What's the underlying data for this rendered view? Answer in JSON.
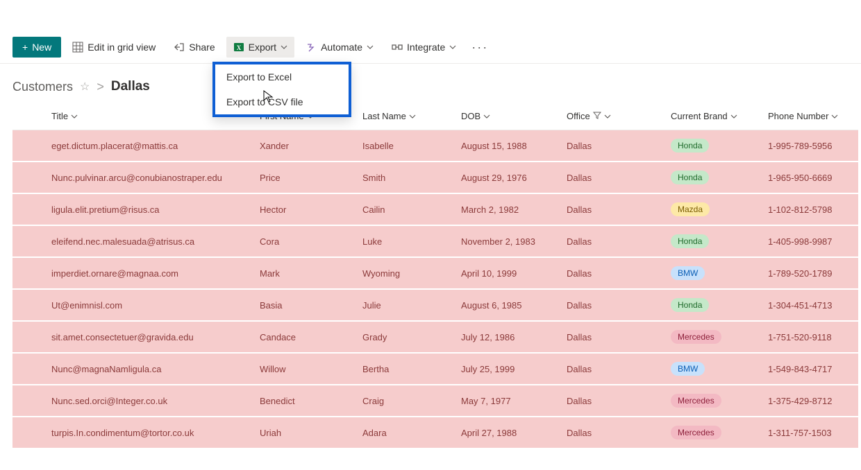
{
  "toolbar": {
    "new_label": "New",
    "edit_label": "Edit in grid view",
    "share_label": "Share",
    "export_label": "Export",
    "automate_label": "Automate",
    "integrate_label": "Integrate"
  },
  "export_menu": {
    "excel": "Export to Excel",
    "csv": "Export to CSV file"
  },
  "breadcrumb": {
    "root": "Customers",
    "current": "Dallas"
  },
  "columns": {
    "title": "Title",
    "first_name": "First Name",
    "last_name": "Last Name",
    "dob": "DOB",
    "office": "Office",
    "brand": "Current Brand",
    "phone": "Phone Number"
  },
  "rows": [
    {
      "title": "eget.dictum.placerat@mattis.ca",
      "first": "Xander",
      "last": "Isabelle",
      "dob": "August 15, 1988",
      "office": "Dallas",
      "brand": "Honda",
      "brand_class": "honda",
      "phone": "1-995-789-5956"
    },
    {
      "title": "Nunc.pulvinar.arcu@conubianostraper.edu",
      "first": "Price",
      "last": "Smith",
      "dob": "August 29, 1976",
      "office": "Dallas",
      "brand": "Honda",
      "brand_class": "honda",
      "phone": "1-965-950-6669"
    },
    {
      "title": "ligula.elit.pretium@risus.ca",
      "first": "Hector",
      "last": "Cailin",
      "dob": "March 2, 1982",
      "office": "Dallas",
      "brand": "Mazda",
      "brand_class": "mazda",
      "phone": "1-102-812-5798"
    },
    {
      "title": "eleifend.nec.malesuada@atrisus.ca",
      "first": "Cora",
      "last": "Luke",
      "dob": "November 2, 1983",
      "office": "Dallas",
      "brand": "Honda",
      "brand_class": "honda",
      "phone": "1-405-998-9987"
    },
    {
      "title": "imperdiet.ornare@magnaa.com",
      "first": "Mark",
      "last": "Wyoming",
      "dob": "April 10, 1999",
      "office": "Dallas",
      "brand": "BMW",
      "brand_class": "bmw",
      "phone": "1-789-520-1789"
    },
    {
      "title": "Ut@enimnisl.com",
      "first": "Basia",
      "last": "Julie",
      "dob": "August 6, 1985",
      "office": "Dallas",
      "brand": "Honda",
      "brand_class": "honda",
      "phone": "1-304-451-4713"
    },
    {
      "title": "sit.amet.consectetuer@gravida.edu",
      "first": "Candace",
      "last": "Grady",
      "dob": "July 12, 1986",
      "office": "Dallas",
      "brand": "Mercedes",
      "brand_class": "mercedes",
      "phone": "1-751-520-9118"
    },
    {
      "title": "Nunc@magnaNamligula.ca",
      "first": "Willow",
      "last": "Bertha",
      "dob": "July 25, 1999",
      "office": "Dallas",
      "brand": "BMW",
      "brand_class": "bmw",
      "phone": "1-549-843-4717"
    },
    {
      "title": "Nunc.sed.orci@Integer.co.uk",
      "first": "Benedict",
      "last": "Craig",
      "dob": "May 7, 1977",
      "office": "Dallas",
      "brand": "Mercedes",
      "brand_class": "mercedes",
      "phone": "1-375-429-8712"
    },
    {
      "title": "turpis.In.condimentum@tortor.co.uk",
      "first": "Uriah",
      "last": "Adara",
      "dob": "April 27, 1988",
      "office": "Dallas",
      "brand": "Mercedes",
      "brand_class": "mercedes",
      "phone": "1-311-757-1503"
    }
  ]
}
